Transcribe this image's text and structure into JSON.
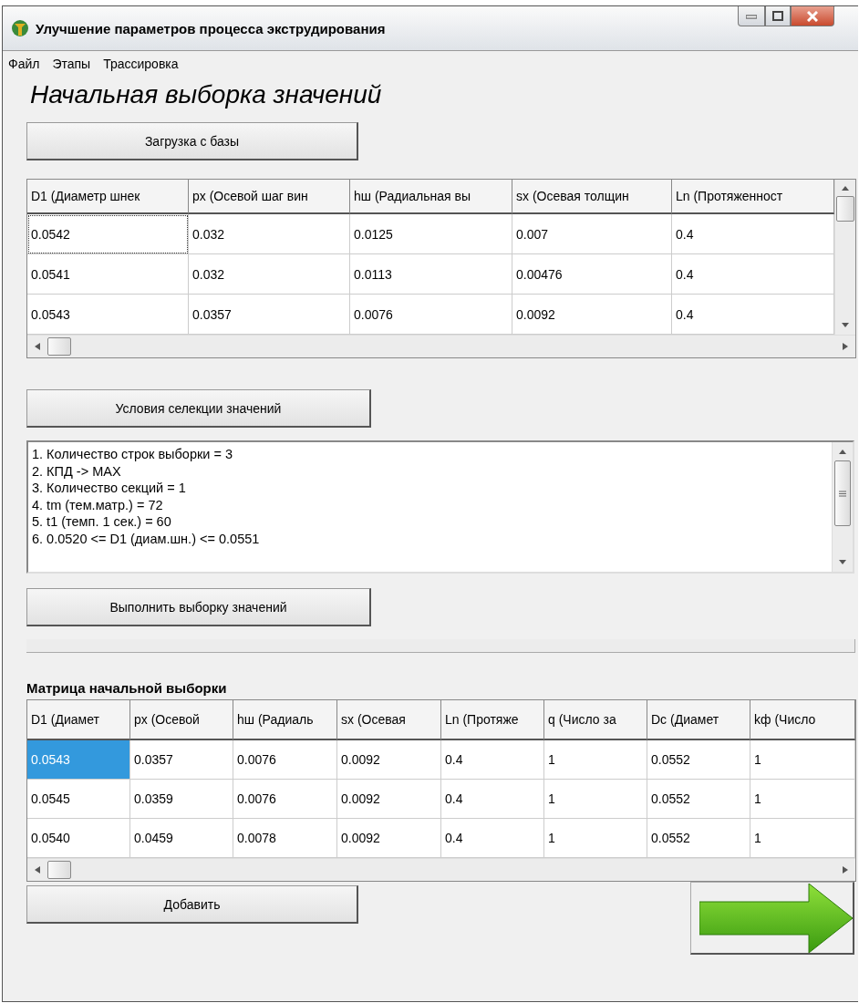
{
  "window": {
    "title": "Улучшение параметров процесса экструдирования"
  },
  "menu": [
    "Файл",
    "Этапы",
    "Трассировка"
  ],
  "heading": "Начальная выборка значений",
  "load_button": "Загрузка с базы",
  "source_grid": {
    "columns": [
      "D1 (Диаметр шнек",
      "px (Осевой шаг вин",
      "hш (Радиальная вы",
      "sx (Осевая толщин",
      "Ln (Протяженност"
    ],
    "rows": [
      {
        "selected": true,
        "cells": [
          "0.0542",
          "0.032",
          "0.0125",
          "0.007",
          "0.4"
        ]
      },
      {
        "selected": false,
        "cells": [
          "0.0541",
          "0.032",
          "0.0113",
          "0.00476",
          "0.4"
        ]
      },
      {
        "selected": false,
        "cells": [
          "0.0543",
          "0.0357",
          "0.0076",
          "0.0092",
          "0.4"
        ]
      }
    ]
  },
  "conditions_button": "Условия селекции значений",
  "conditions": [
    "1. Количество строк выборки = 3",
    "2. КПД -> MAX",
    "3. Количество секций = 1",
    "4. tm (тем.матр.) = 72",
    "5. t1 (темп. 1 сек.) = 60",
    "6. 0.0520 <= D1 (диам.шн.) <= 0.0551"
  ],
  "run_button": "Выполнить выборку значений",
  "matrix_label": "Матрица начальной выборки",
  "matrix_grid": {
    "columns": [
      "D1 (Диамет",
      "px (Осевой",
      "hш (Радиаль",
      "sx (Осевая",
      "Ln (Протяже",
      "q (Число за",
      "Dc (Диамет",
      "kф (Число"
    ],
    "rows": [
      {
        "selected": true,
        "cells": [
          "0.0543",
          "0.0357",
          "0.0076",
          "0.0092",
          "0.4",
          "1",
          "0.0552",
          "1"
        ]
      },
      {
        "selected": false,
        "cells": [
          "0.0545",
          "0.0359",
          "0.0076",
          "0.0092",
          "0.4",
          "1",
          "0.0552",
          "1"
        ]
      },
      {
        "selected": false,
        "cells": [
          "0.0540",
          "0.0459",
          "0.0078",
          "0.0092",
          "0.4",
          "1",
          "0.0552",
          "1"
        ]
      }
    ]
  },
  "add_button": "Добавить"
}
